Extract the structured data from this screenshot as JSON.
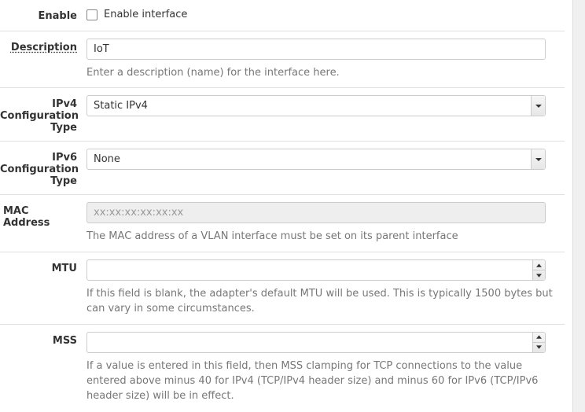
{
  "labels": {
    "enable": "Enable",
    "description": "Description",
    "ipv4": "IPv4 Configuration Type",
    "ipv6": "IPv6 Configuration Type",
    "mac": "MAC Address",
    "mtu": "MTU",
    "mss": "MSS"
  },
  "fields": {
    "enable": {
      "checkbox_label": "Enable interface",
      "checked": false
    },
    "description": {
      "value": "IoT",
      "help": "Enter a description (name) for the interface here."
    },
    "ipv4": {
      "selected": "Static IPv4"
    },
    "ipv6": {
      "selected": "None"
    },
    "mac": {
      "placeholder": "xx:xx:xx:xx:xx:xx",
      "value": "",
      "help": "The MAC address of a VLAN interface must be set on its parent interface"
    },
    "mtu": {
      "value": "",
      "help": "If this field is blank, the adapter's default MTU will be used. This is typically 1500 bytes but can vary in some circumstances."
    },
    "mss": {
      "value": "",
      "help": "If a value is entered in this field, then MSS clamping for TCP connections to the value entered above minus 40 for IPv4 (TCP/IPv4 header size) and minus 60 for IPv6 (TCP/IPv6 header size) will be in effect."
    }
  }
}
